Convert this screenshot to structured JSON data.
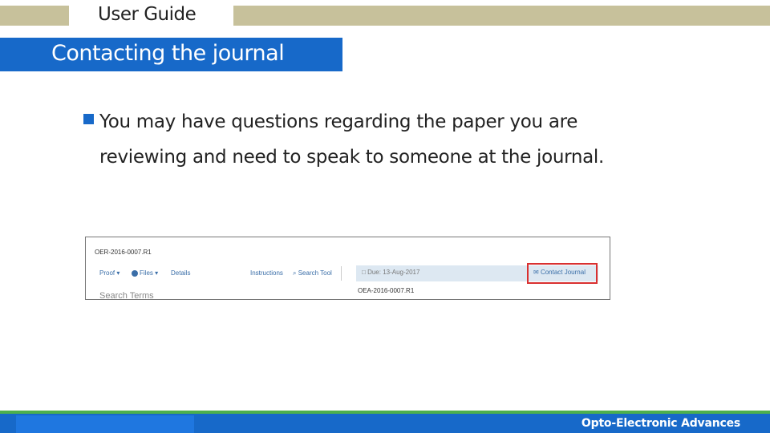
{
  "header": {
    "guide_title": "User Guide",
    "section_title": "Contacting the journal"
  },
  "body": {
    "bullet_text": "You may have questions regarding the paper you are reviewing and need to speak to someone at the journal."
  },
  "screenshot": {
    "manuscript_id": "OER-2016-0007.R1",
    "nav": {
      "proof": "Proof ▾",
      "files": "Files ▾",
      "details": "Details",
      "instructions": "Instructions",
      "search_tool": "Search Tool"
    },
    "search_terms": "Search Terms",
    "due": "Due: 13-Aug-2017",
    "contact_journal": "Contact Journal",
    "oea_id": "OEA-2016-0007.R1"
  },
  "footer": {
    "journal_name": "Opto-Electronic Advances"
  },
  "colors": {
    "accent_blue": "#1769c9",
    "tan": "#c7c19b",
    "green": "#4db04d",
    "highlight_red": "#d93030"
  }
}
